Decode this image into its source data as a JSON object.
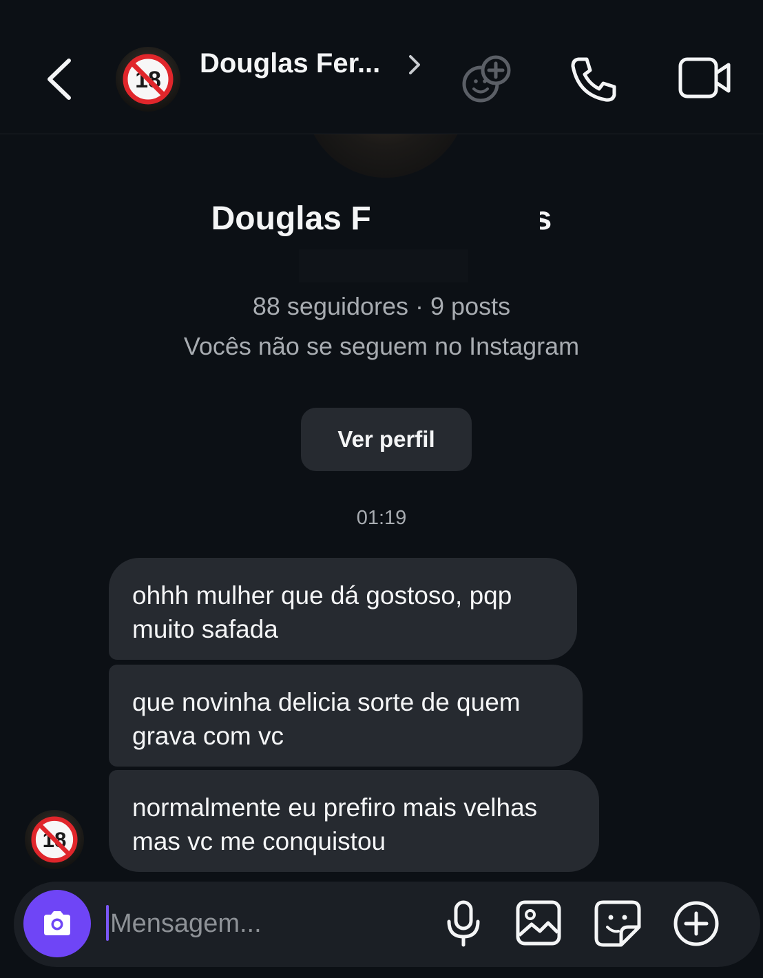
{
  "header": {
    "title": "Douglas Fer...",
    "back_icon": "chevron-left-icon",
    "title_icon": "chevron-right-icon",
    "actions": [
      "add-people-icon",
      "phone-icon",
      "video-camera-icon"
    ]
  },
  "profile": {
    "avatar_badge": "18",
    "name": "Douglas F",
    "name_tail": "s",
    "stats": "88 seguidores · 9 posts",
    "follow_status": "Vocês não se seguem no Instagram",
    "view_profile_label": "Ver perfil"
  },
  "conversation": {
    "timestamp": "01:19",
    "messages": [
      {
        "lines": [
          "ohhh mulher que dá gostoso, pqp",
          "muito safada"
        ]
      },
      {
        "lines": [
          "que novinha delicia sorte de quem",
          "grava com vc"
        ]
      },
      {
        "lines": [
          "normalmente eu prefiro mais velhas",
          "mas vc me conquistou"
        ]
      }
    ],
    "sender_badge": "18"
  },
  "composer": {
    "placeholder": "Mensagem...",
    "camera_icon": "camera-icon",
    "actions": [
      "microphone-icon",
      "gallery-icon",
      "sticker-icon",
      "plus-circle-icon"
    ]
  },
  "colors": {
    "background": "#0c1015",
    "bubble": "#262a30",
    "secondary_text": "#a8acb1",
    "accent": "#6f45f6",
    "badge_red": "#e0262b"
  }
}
